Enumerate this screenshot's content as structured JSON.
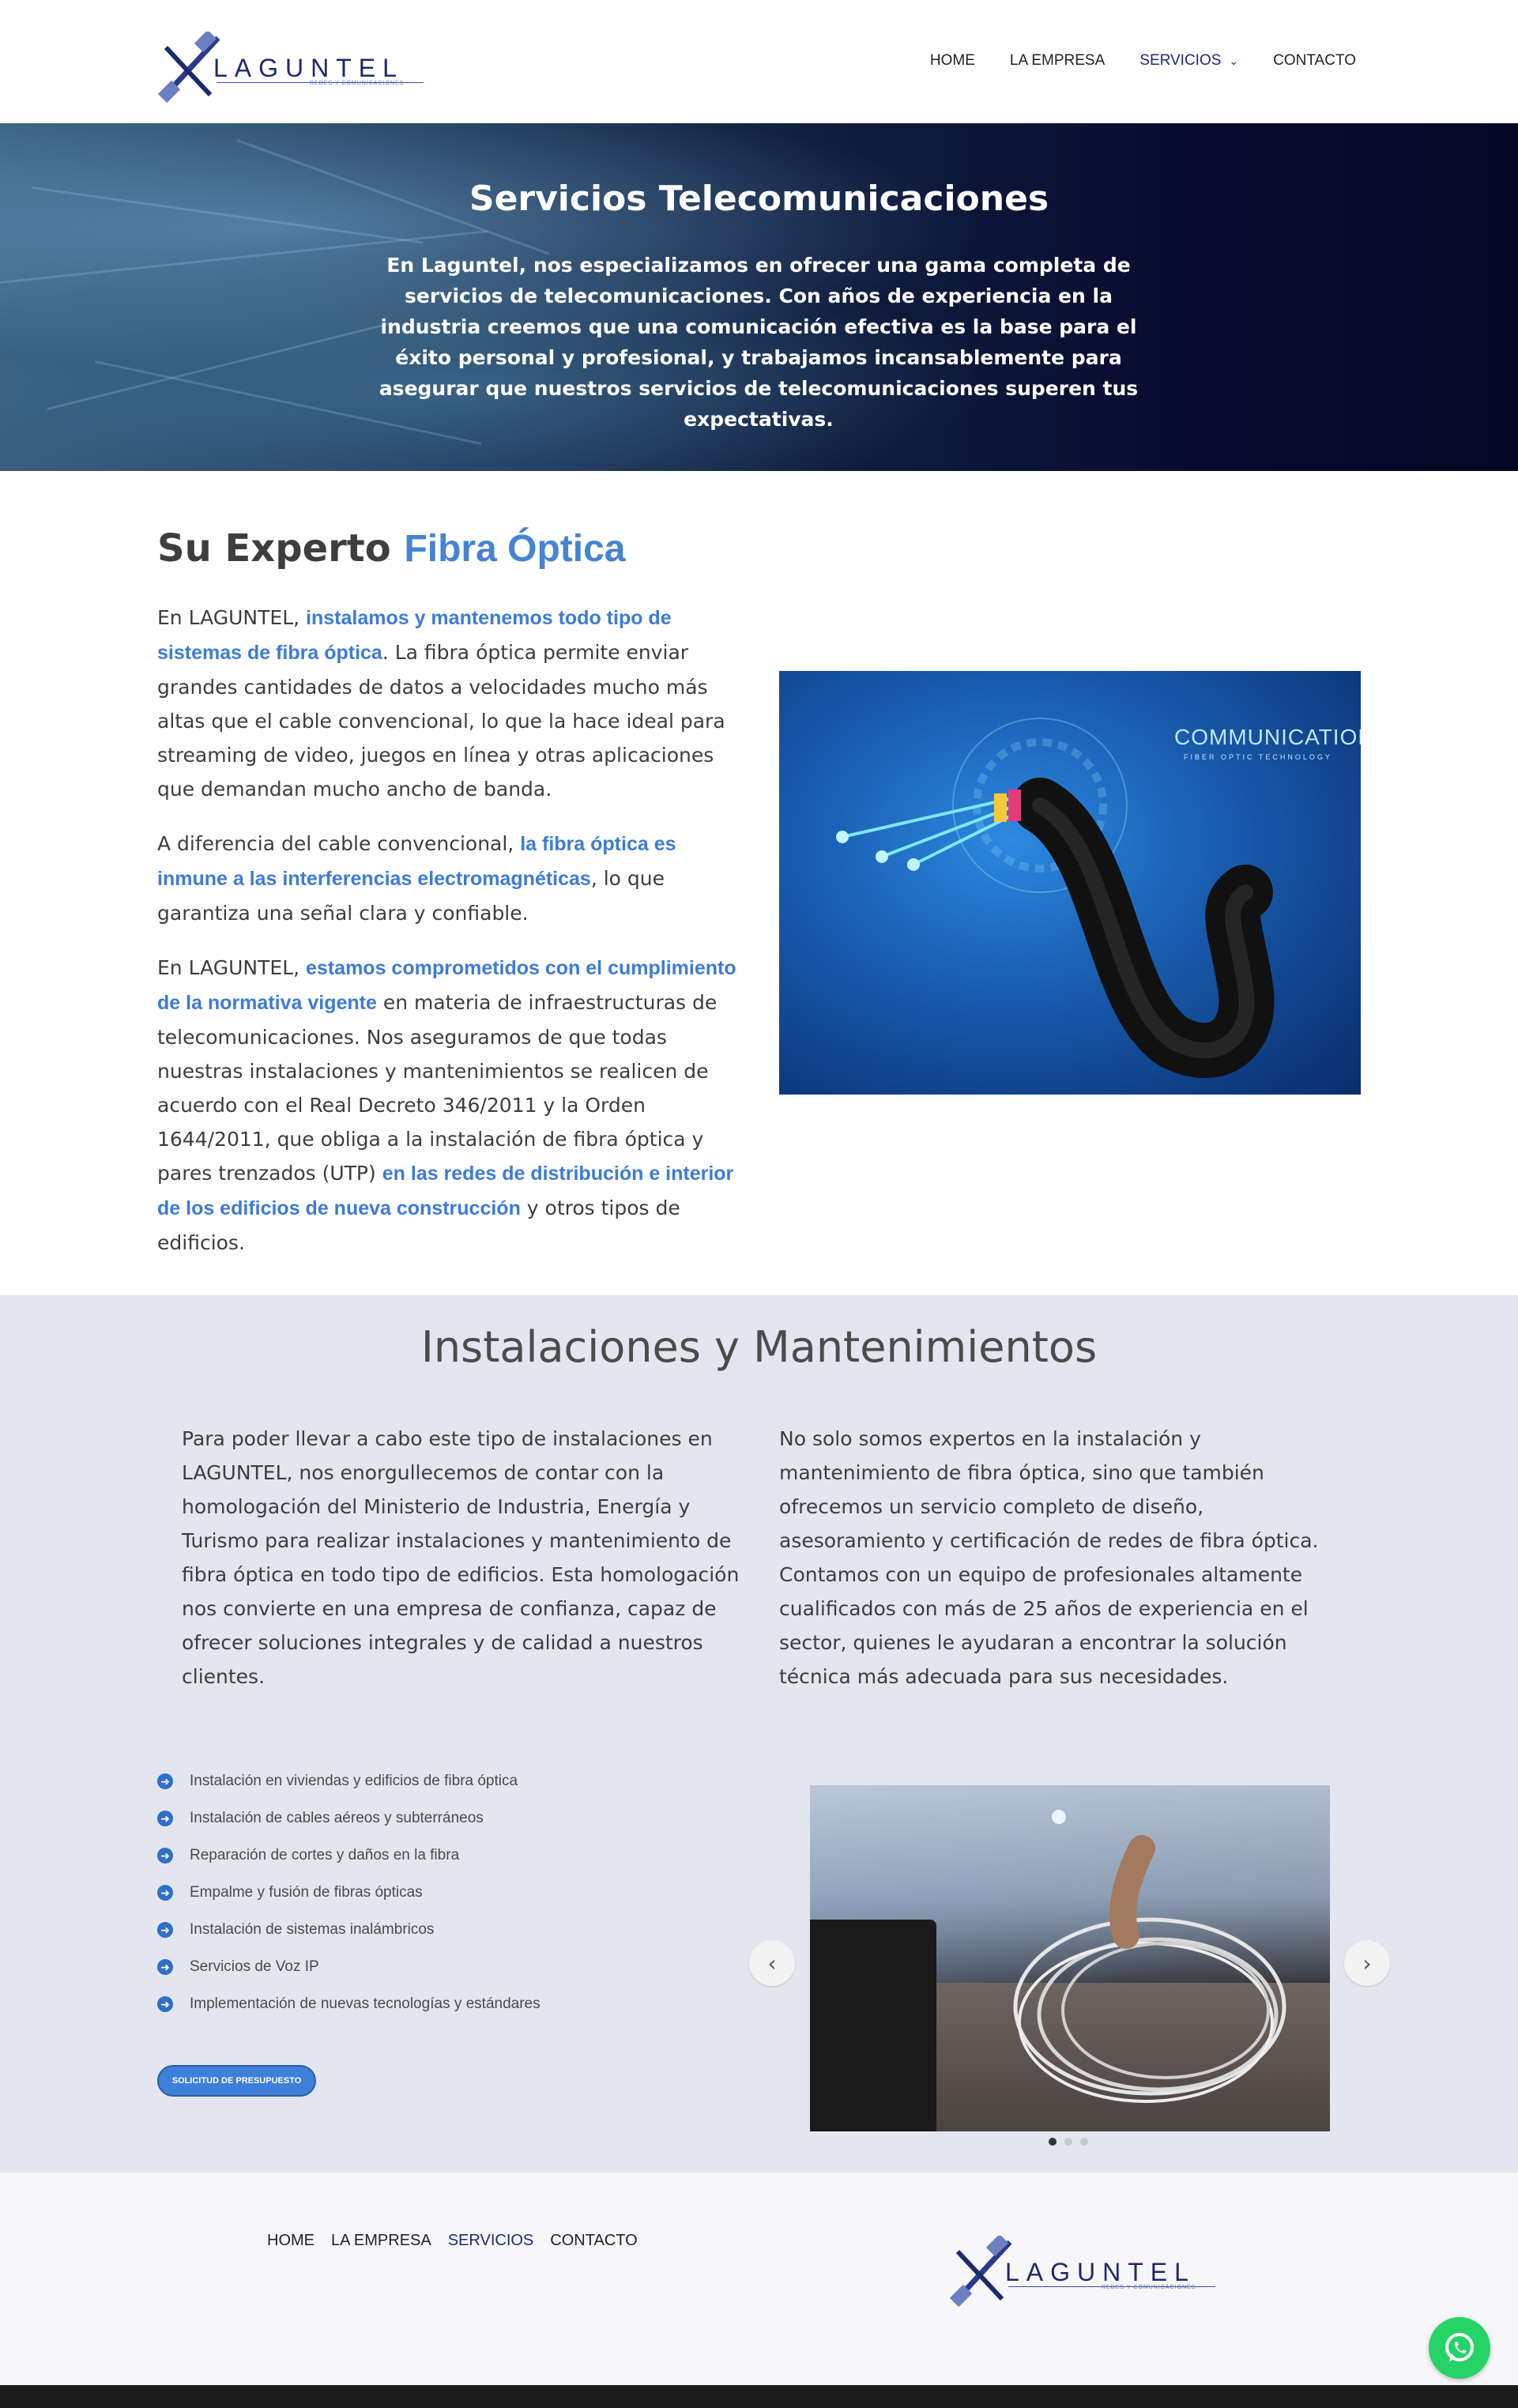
{
  "brand": {
    "name": "LAGUNTEL",
    "tagline": "REDES Y COMUNICACIONES"
  },
  "nav": [
    {
      "label": "HOME",
      "active": false
    },
    {
      "label": "LA EMPRESA",
      "active": false
    },
    {
      "label": "SERVICIOS",
      "active": true,
      "icon": "chevron-down-icon"
    },
    {
      "label": "CONTACTO",
      "active": false
    }
  ],
  "hero": {
    "title": "Servicios Telecomunicaciones",
    "text": "En Laguntel, nos especializamos en ofrecer una gama completa de servicios de telecomunicaciones. Con años de experiencia en la industria creemos que una comunicación efectiva es la base para el éxito personal y profesional, y trabajamos incansablemente para asegurar que nuestros servicios de telecomunicaciones superen tus expectativas."
  },
  "fibra": {
    "title_a": "Su Experto",
    "title_b": "Fibra Óptica",
    "p1": {
      "a": "En LAGUNTEL,",
      "hl": "instalamos y mantenemos todo tipo de sistemas de fibra óptica",
      "b": ". La fibra óptica permite enviar grandes cantidades de datos a velocidades mucho más altas que el cable convencional, lo que la hace ideal para streaming de video, juegos en línea y otras aplicaciones que demandan mucho ancho de banda."
    },
    "p2": {
      "a": "A diferencia del cable convencional,",
      "hl": "la fibra óptica es inmune a las interferencias electromagnéticas",
      "b": ", lo que garantiza una señal clara y confiable."
    },
    "p3": {
      "a": "En LAGUNTEL,",
      "hl1": "estamos comprometidos con el cumplimiento de la normativa vigente",
      "b": "en materia de infraestructuras de telecomunicaciones. Nos aseguramos de que todas nuestras instalaciones y mantenimientos se realicen de acuerdo con el Real Decreto 346/2011 y la Orden 1644/2011, que obliga a la instalación de fibra óptica y pares trenzados (UTP)",
      "hl2": "en las redes de distribución e interior de los edificios de nueva construcción",
      "c": "y otros tipos de edificios."
    },
    "image": {
      "title": "COMMUNICATION",
      "subtitle": "FIBER OPTIC TECHNOLOGY"
    }
  },
  "instalaciones": {
    "title": "Instalaciones y Mantenimientos",
    "left": "Para poder llevar a cabo este tipo de instalaciones en LAGUNTEL, nos enorgullecemos de contar con la homologación del Ministerio de Industria, Energía y Turismo para realizar instalaciones y mantenimiento de fibra óptica en todo tipo de edificios. Esta homologación nos convierte en una empresa de confianza, capaz de ofrecer soluciones integrales y de calidad a nuestros clientes.",
    "right": "No solo somos expertos en la instalación y mantenimiento de fibra óptica, sino que también ofrecemos un servicio completo de diseño, asesoramiento y certificación de redes de fibra óptica. Contamos con un equipo de profesionales altamente cualificados con más de 25 años de experiencia en el sector, quienes le ayudaran a encontrar la solución técnica más adecuada para sus necesidades.",
    "list": [
      "Instalación en viviendas y edificios de fibra óptica",
      "Instalación de cables aéreos y subterráneos",
      "Reparación de cortes y daños en la fibra",
      "Empalme y fusión de fibras ópticas",
      "Instalación de sistemas inalámbricos",
      "Servicios de Voz IP",
      "Implementación de nuevas tecnologías y estándares"
    ],
    "button": "SOLICITUD DE PRESUPUESTO",
    "slider": {
      "slides": 3,
      "current": 1
    }
  },
  "footer": {
    "nav": [
      {
        "label": "HOME",
        "active": false
      },
      {
        "label": "LA EMPRESA",
        "active": false
      },
      {
        "label": "SERVICIOS",
        "active": true
      },
      {
        "label": "CONTACTO",
        "active": false
      }
    ]
  },
  "colors": {
    "accent": "#3d7bd6",
    "navy": "#1f2b74",
    "section_bg": "#e4e6ef",
    "whatsapp": "#25d366"
  }
}
